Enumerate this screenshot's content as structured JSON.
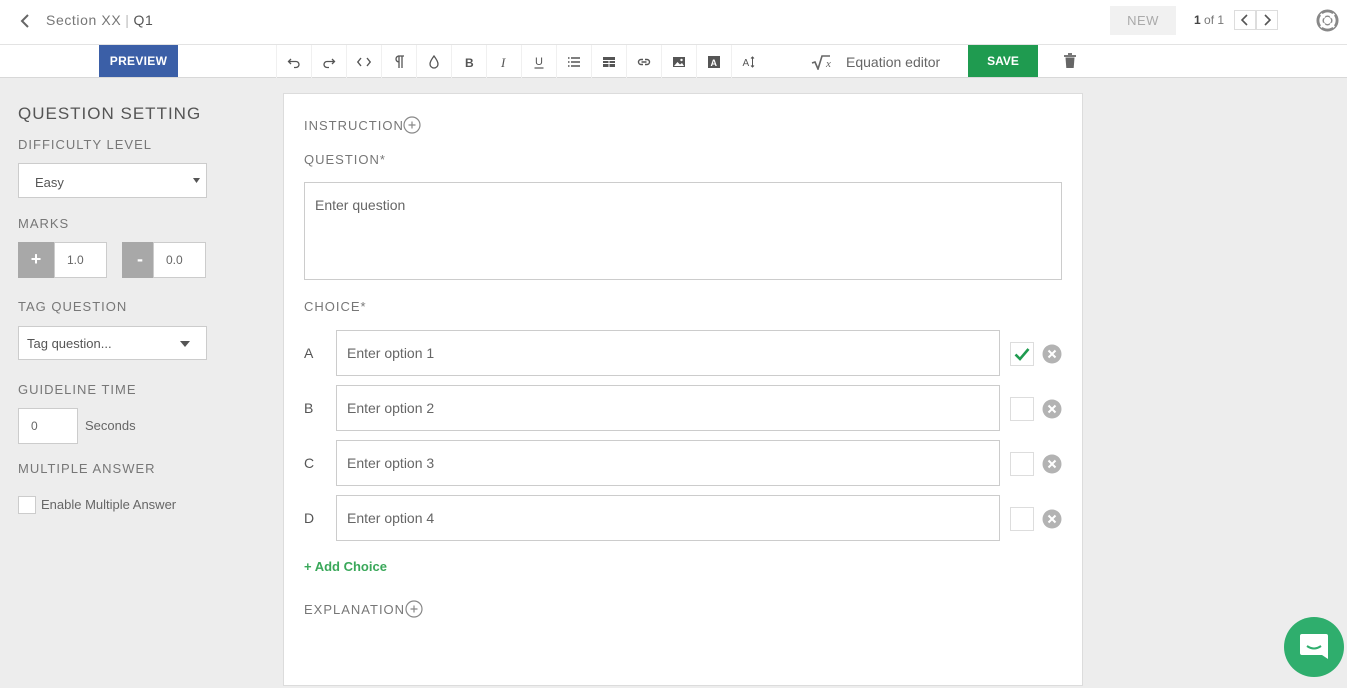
{
  "header": {
    "section": "Section XX",
    "separator": "|",
    "question_id": "Q1",
    "new_label": "NEW",
    "pager_current": "1",
    "pager_rest": " of 1"
  },
  "toolbar": {
    "preview_label": "PREVIEW",
    "equation_label": "Equation editor",
    "save_label": "SAVE",
    "icons": [
      "undo-icon",
      "redo-icon",
      "code-icon",
      "paragraph-icon",
      "color-drop-icon",
      "bold-icon",
      "italic-icon",
      "underline-icon",
      "list-icon",
      "table-icon",
      "link-icon",
      "image-icon",
      "text-box-icon",
      "font-size-icon"
    ]
  },
  "sidebar": {
    "title": "QUESTION SETTING",
    "difficulty_label": "DIFFICULTY LEVEL",
    "difficulty_value": "Easy",
    "marks_label": "MARKS",
    "marks_plus_symbol": "+",
    "marks_minus_symbol": "-",
    "marks_positive": "1.0",
    "marks_negative": "0.0",
    "tag_label": "TAG QUESTION",
    "tag_placeholder": "Tag question...",
    "guideline_label": "GUIDELINE TIME",
    "guideline_value": "0",
    "guideline_unit": "Seconds",
    "multiple_label": "MULTIPLE ANSWER",
    "multiple_checkbox_label": "Enable Multiple Answer"
  },
  "editor": {
    "instruction_label": "INSTRUCTION",
    "question_label": "QUESTION*",
    "question_placeholder": "Enter question",
    "choice_label": "CHOICE*",
    "options": [
      {
        "letter": "A",
        "placeholder": "Enter option 1",
        "correct": true
      },
      {
        "letter": "B",
        "placeholder": "Enter option 2",
        "correct": false
      },
      {
        "letter": "C",
        "placeholder": "Enter option 3",
        "correct": false
      },
      {
        "letter": "D",
        "placeholder": "Enter option 4",
        "correct": false
      }
    ],
    "add_choice_label": "+ Add Choice",
    "explanation_label": "EXPLANATION"
  },
  "colors": {
    "preview": "#3b5fa7",
    "save": "#1f9b50",
    "check": "#1f9b50",
    "chat": "#2fae6d"
  }
}
